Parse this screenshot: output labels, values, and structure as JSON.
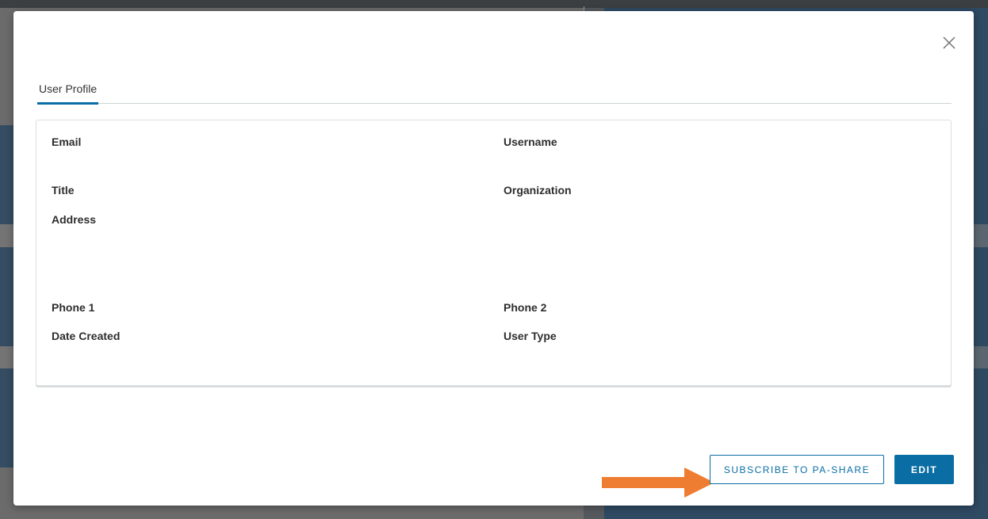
{
  "modal": {
    "tabs": [
      {
        "label": "User Profile"
      }
    ],
    "fields": {
      "email": "Email",
      "username": "Username",
      "title": "Title",
      "organization": "Organization",
      "address": "Address",
      "phone1": "Phone 1",
      "phone2": "Phone 2",
      "date_created": "Date Created",
      "user_type": "User Type"
    },
    "buttons": {
      "subscribe": "SUBSCRIBE TO PA-SHARE",
      "edit": "EDIT"
    }
  },
  "colors": {
    "accent": "#0a6da4",
    "annotation_arrow": "#ee7d31"
  },
  "icons": {
    "close": "close-icon",
    "arrow": "right-arrow-annotation"
  }
}
